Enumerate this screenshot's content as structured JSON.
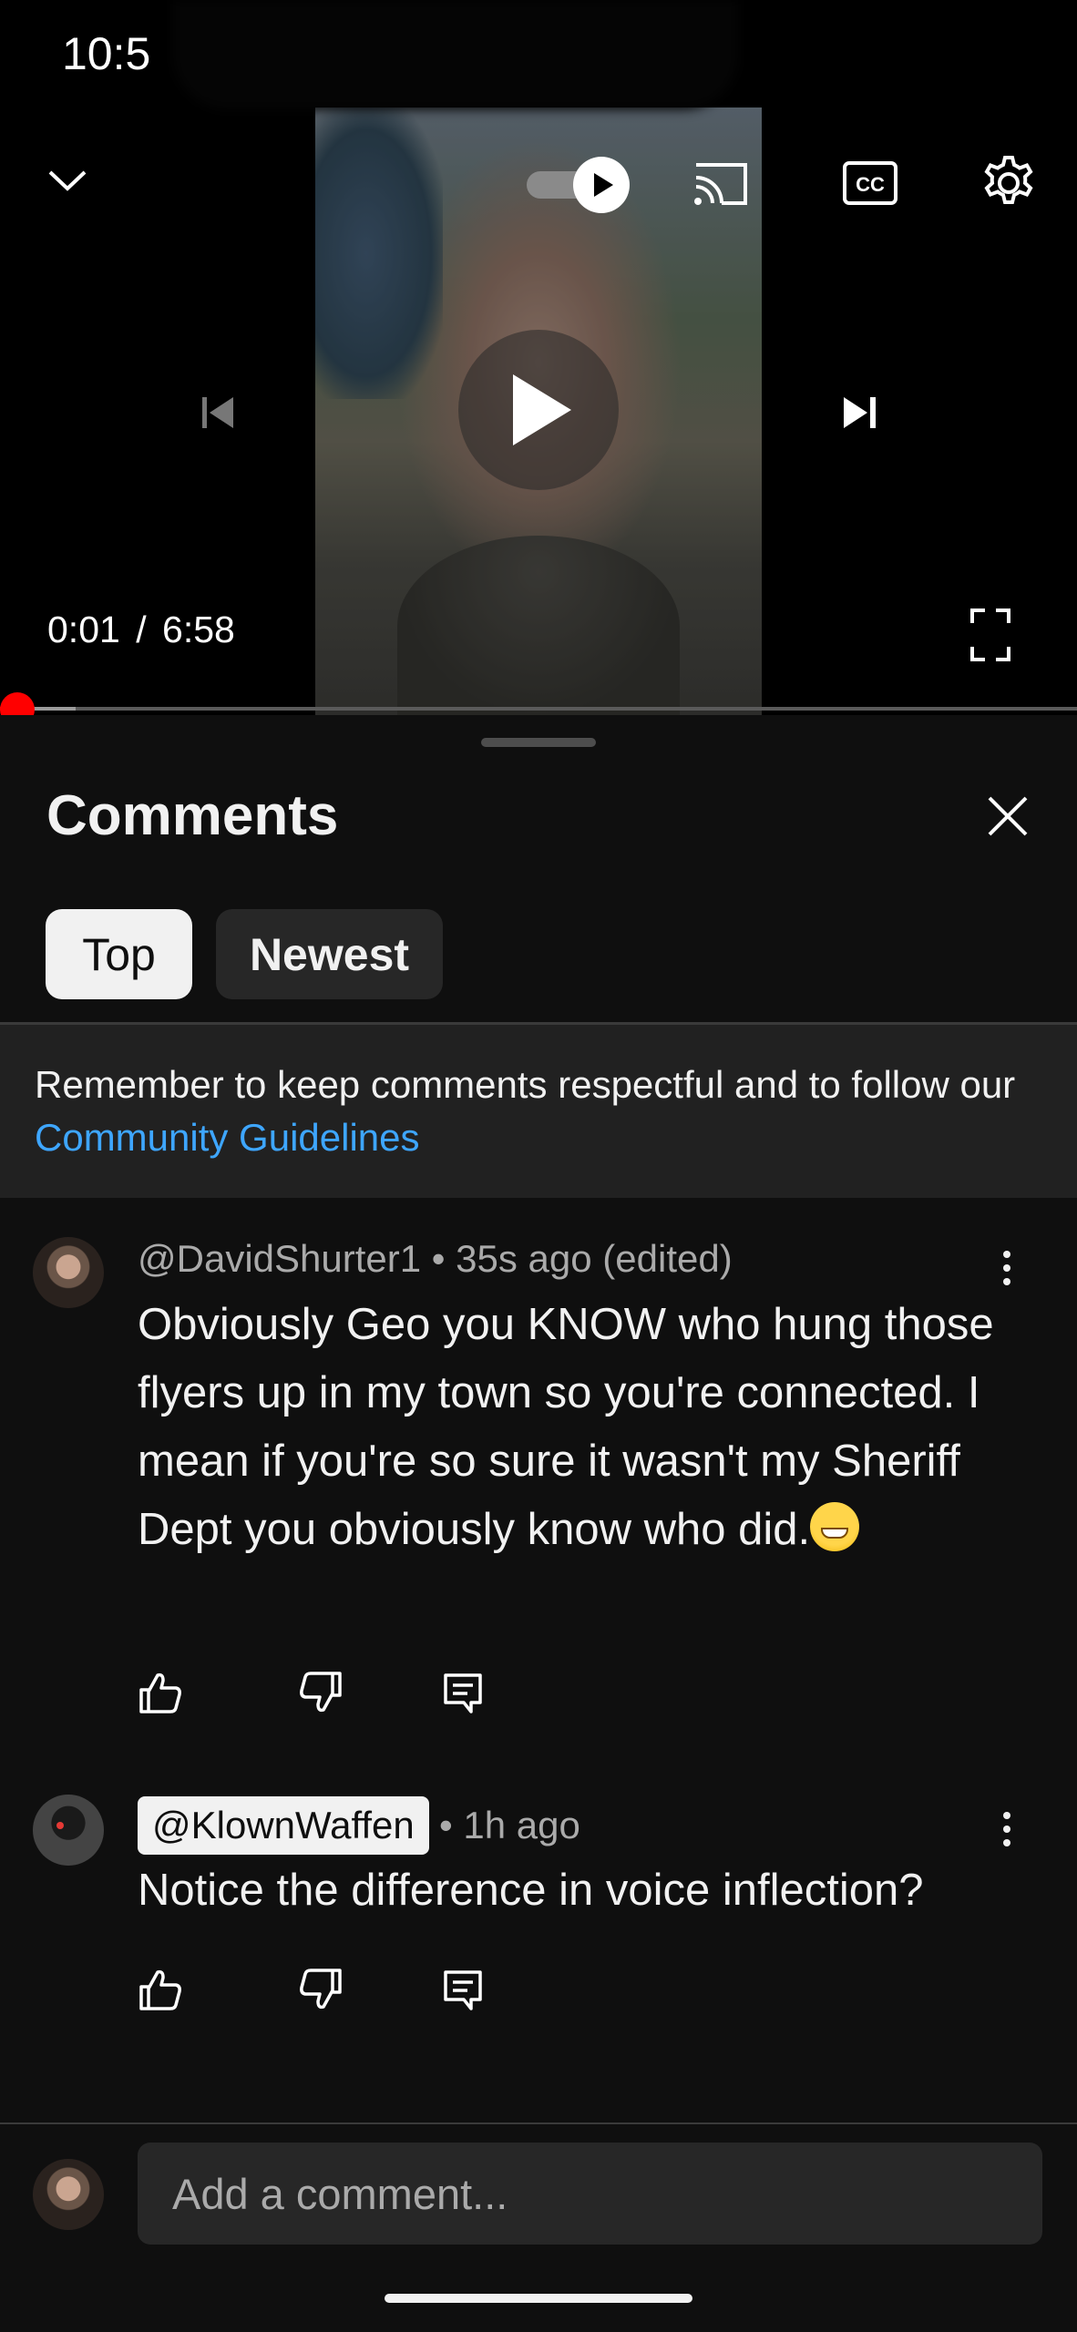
{
  "status_bar": {
    "time": "10:5"
  },
  "player": {
    "current_time": "0:01",
    "separator": "/",
    "duration": "6:58",
    "progress_fraction": 0.0024,
    "buffer_fraction": 0.07,
    "autoplay": true
  },
  "comments_panel": {
    "title": "Comments",
    "sort_chips": [
      {
        "label": "Top",
        "selected": true
      },
      {
        "label": "Newest",
        "selected": false
      }
    ],
    "notice": {
      "text": "Remember to keep comments respectful and to follow our ",
      "link": "Community Guidelines"
    },
    "comments": [
      {
        "author": "@DavidShurter1",
        "meta": "• 35s ago (edited)",
        "text": "Obviously Geo you KNOW who hung those flyers up in my town so you're connected. I mean if you're so sure it wasn't my Sheriff Dept you obviously know who did.",
        "emoji": "grinning-face"
      },
      {
        "author": "@KlownWaffen",
        "meta": "• 1h ago",
        "text": "Notice the difference in voice inflection?"
      }
    ],
    "add_comment_placeholder": "Add a comment..."
  },
  "colors": {
    "background": "#0f0f0f",
    "progress": "#ff0000",
    "link": "#3ea6ff",
    "chip_selected": "#f1f1f1",
    "chip": "#272727"
  }
}
